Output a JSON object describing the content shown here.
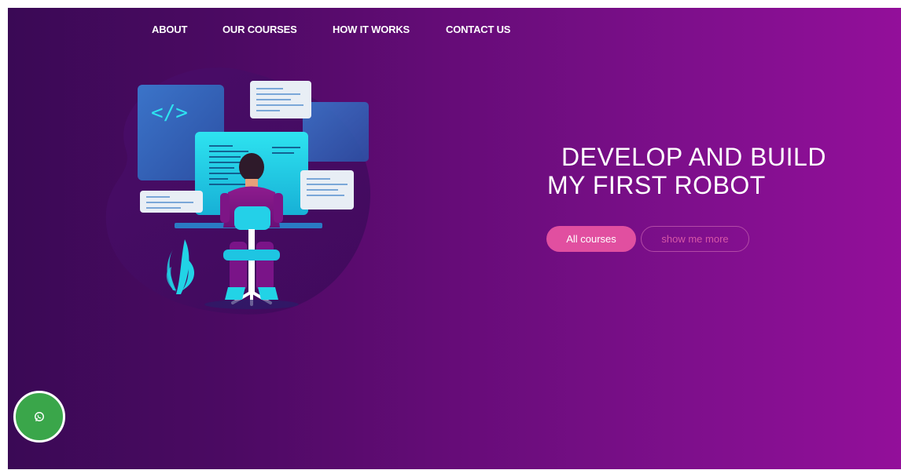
{
  "nav": {
    "items": [
      {
        "label": "ABOUT"
      },
      {
        "label": "OUR COURSES"
      },
      {
        "label": "HOW IT WORKS"
      },
      {
        "label": "CONTACT US"
      }
    ]
  },
  "hero": {
    "headline_line1": "DEVELOP AND BUILD",
    "headline_line2": "MY FIRST ROBOT",
    "primary_button": "All courses",
    "secondary_button": "show me more",
    "code_symbol": "</>",
    "illustration_icon": "developer-at-desk-illustration"
  },
  "floating": {
    "icon": "whatsapp-icon"
  },
  "colors": {
    "background_start": "#3a0955",
    "background_end": "#930f9a",
    "primary_button": "#e14fa0",
    "outline_button": "#b24aa6",
    "whatsapp": "#3aa64a",
    "cyan_accent": "#22d3e6"
  }
}
